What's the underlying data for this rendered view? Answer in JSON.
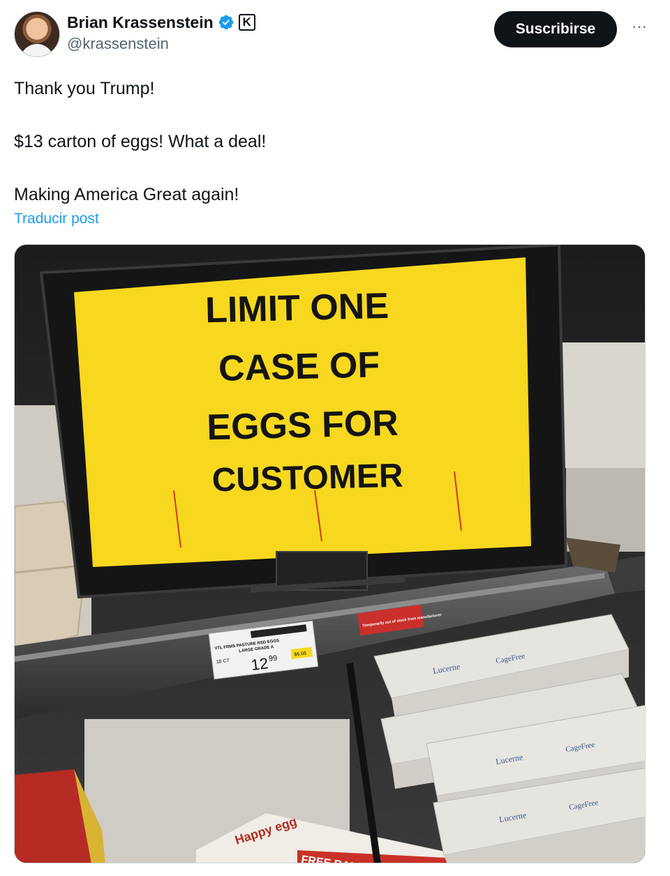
{
  "author": {
    "name": "Brian Krassenstein",
    "handle": "@krassenstein",
    "verified_icon": "verified-badge-icon",
    "affiliate_icon": "k-affiliate-icon",
    "affiliate_letter": "K"
  },
  "actions": {
    "subscribe_label": "Suscribirse",
    "more_label": "···"
  },
  "post": {
    "lines": [
      "Thank you Trump!",
      "$13 carton of eggs!  What a deal!",
      "Making America Great again!"
    ],
    "translate_label": "Traducir post"
  },
  "image": {
    "sign_lines": [
      "LIMIT ONE",
      "CASE OF",
      "EGGS FOR",
      "CUSTOMER"
    ],
    "price_tag": {
      "product": "VTL FRMS PASTURE RSD EGGS",
      "grade": "LARGE GRADE A",
      "count": "18 CT",
      "price_main": "12",
      "price_cents": "99",
      "unit_price": "$6.66"
    },
    "out_of_stock_label": "Temporarily out of stock from manufacturer",
    "carton_brand": "Lucerne",
    "carton_label": "CageFree",
    "box_brand_left": "Happy egg",
    "box_label_left": "FREE RANGE"
  },
  "colors": {
    "subscribe_bg": "#0f1419",
    "link": "#1d9bf0",
    "verified": "#1d9bf0",
    "sign_yellow": "#f7d81f"
  }
}
